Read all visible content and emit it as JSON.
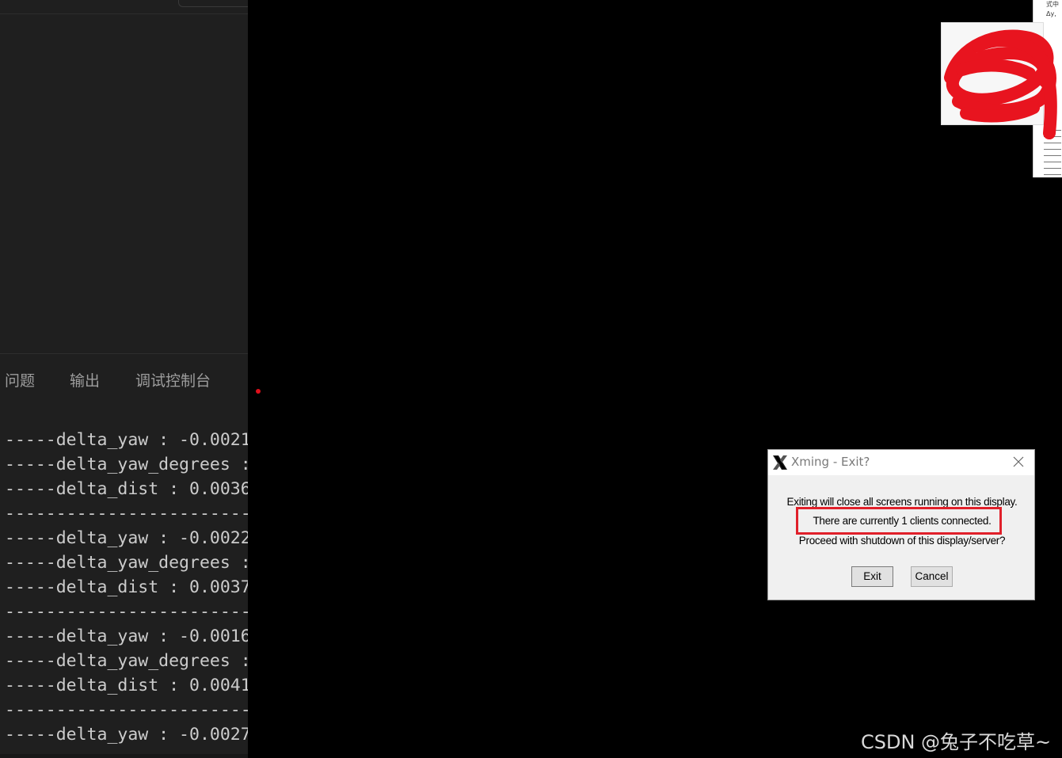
{
  "editor": {
    "panel_tabs": [
      "问题",
      "输出",
      "调试控制台"
    ],
    "terminal_lines": [
      "-----delta_yaw : -0.0021",
      "-----delta_yaw_degrees :",
      "-----delta_dist : 0.0036",
      "------------------------",
      "-----delta_yaw : -0.0022",
      "-----delta_yaw_degrees :",
      "-----delta_dist : 0.0037",
      "------------------------",
      "-----delta_yaw : -0.0016",
      "-----delta_yaw_degrees :",
      "-----delta_dist : 0.0041",
      "------------------------",
      "-----delta_yaw : -0.0027"
    ]
  },
  "thumbnail": {
    "text_1": "式中",
    "text_2": "Δy,"
  },
  "dialog": {
    "title": "Xming - Exit?",
    "message_1": "Exiting will close all screens running on this display.",
    "message_2": "There are currently 1 clients connected.",
    "message_3": "Proceed with shutdown of this display/server?",
    "exit_label": "Exit",
    "cancel_label": "Cancel"
  },
  "watermark": "CSDN @兔子不吃草~",
  "colors": {
    "highlight": "#e0202a",
    "scribble": "#e8141f",
    "editor_bg": "#1f1f1f"
  }
}
